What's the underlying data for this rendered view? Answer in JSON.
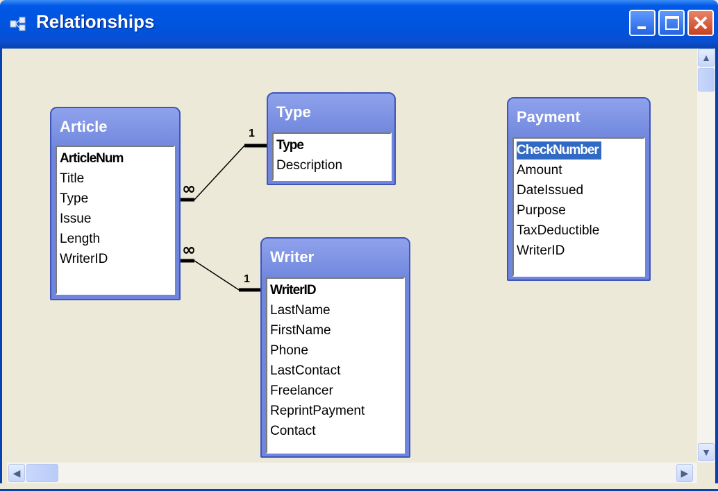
{
  "window": {
    "title": "Relationships"
  },
  "tables": {
    "article": {
      "name": "Article",
      "fields": [
        "ArticleNum",
        "Title",
        "Type",
        "Issue",
        "Length",
        "WriterID"
      ]
    },
    "type": {
      "name": "Type",
      "fields": [
        "Type",
        "Description"
      ]
    },
    "writer": {
      "name": "Writer",
      "fields": [
        "WriterID",
        "LastName",
        "FirstName",
        "Phone",
        "LastContact",
        "Freelancer",
        "ReprintPayment",
        "Contact"
      ]
    },
    "payment": {
      "name": "Payment",
      "fields": [
        "CheckNumber",
        "Amount",
        "DateIssued",
        "Purpose",
        "TaxDeductible",
        "WriterID"
      ]
    }
  },
  "relationships": {
    "article_type": {
      "one_label": "1",
      "many_label": "∞"
    },
    "article_writer": {
      "one_label": "1",
      "many_label": "∞"
    }
  },
  "selected_field": "Payment.CheckNumber"
}
